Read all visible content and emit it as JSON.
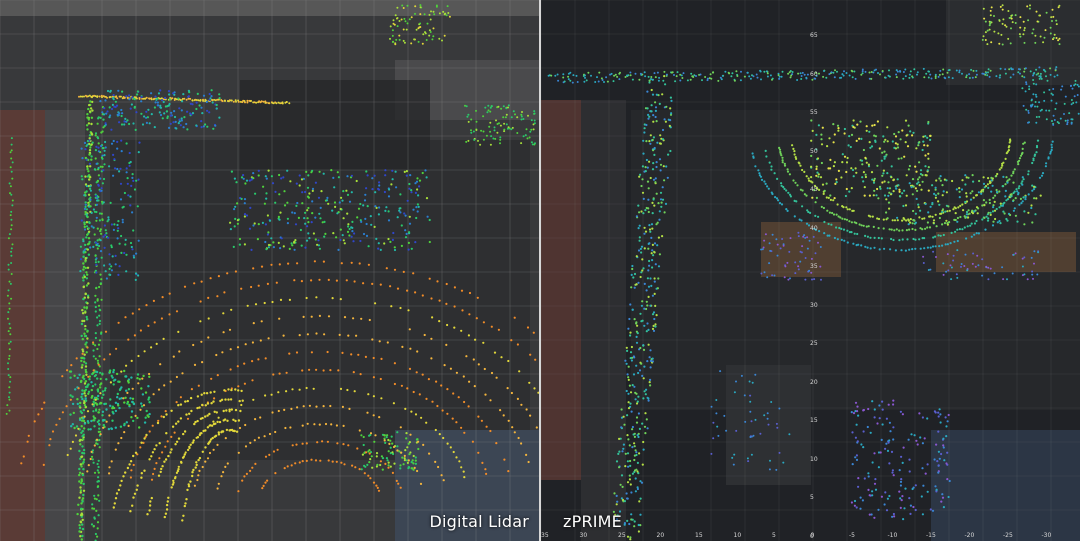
{
  "left_panel": {
    "caption": "Digital Lidar",
    "point_palette": [
      "#f28c28",
      "#f4b53d",
      "#e2d83a",
      "#a8e03a",
      "#4fd23c",
      "#29c96a",
      "#22b8a8",
      "#2a7fd0",
      "#3046c8"
    ]
  },
  "right_panel": {
    "caption": "zPRIME",
    "point_palette": [
      "#e7e34a",
      "#b5e045",
      "#6fd35a",
      "#33c29a",
      "#2aa8c0",
      "#3a86d4",
      "#5a5fcf",
      "#8a57d1"
    ],
    "y_axis_ticks": [
      "65",
      "60",
      "55",
      "50",
      "45",
      "40",
      "35",
      "30",
      "25",
      "20",
      "15",
      "10",
      "5",
      "0"
    ],
    "x_axis_ticks": [
      "35",
      "30",
      "25",
      "20",
      "15",
      "10",
      "5",
      "0",
      "-5",
      "-10",
      "-15",
      "-20",
      "-25",
      "-30"
    ]
  },
  "colors": {
    "divider": "#d7d7d7",
    "caption_text": "#ffffff",
    "grid_line": "#8f8f8f"
  }
}
